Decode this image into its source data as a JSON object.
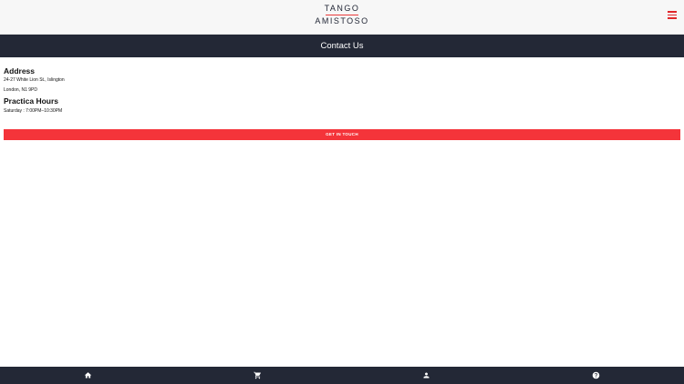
{
  "brand": {
    "line1": "TANGO",
    "line2": "AMISTOSO",
    "accent": "#e83a3a"
  },
  "header": {
    "menu_icon": "hamburger-menu-icon"
  },
  "page": {
    "title": "Contact Us"
  },
  "address": {
    "heading": "Address",
    "line1": "24-27 White Lion St., Islington",
    "line2": "London, N1 9PD"
  },
  "hours": {
    "heading": "Practica Hours",
    "line1": "Saturday : 7:00PM–10:30PM"
  },
  "cta": {
    "label": "GET IN TOUCH",
    "color": "#f4343a"
  },
  "bottom_nav": {
    "items": [
      {
        "icon": "home-icon"
      },
      {
        "icon": "cart-icon"
      },
      {
        "icon": "account-icon"
      },
      {
        "icon": "help-icon"
      }
    ],
    "background": "#232836"
  }
}
